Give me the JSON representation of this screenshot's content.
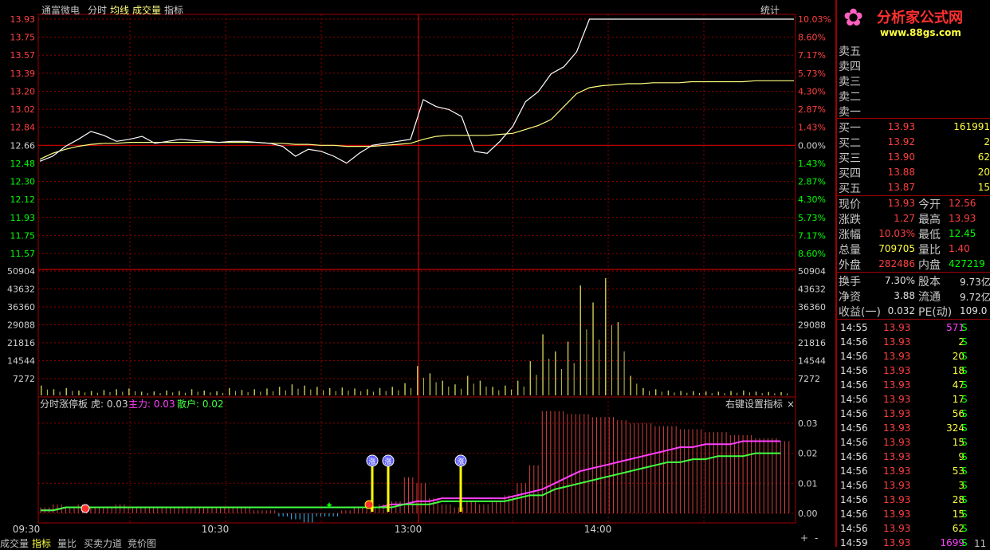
{
  "header": {
    "stock_name": "通富微电",
    "tab_minute": "分时",
    "tab_avg": "均线",
    "tab_volume": "成交量",
    "tab_indicator": "指标",
    "stats_button": "统计"
  },
  "price_axis": {
    "left_labels": [
      "13.93",
      "13.75",
      "13.57",
      "13.39",
      "13.20",
      "13.02",
      "12.84",
      "12.66",
      "12.48",
      "12.30",
      "12.12",
      "11.93",
      "11.75",
      "11.57"
    ],
    "right_labels": [
      "10.03%",
      "8.60%",
      "7.17%",
      "5.73%",
      "4.30%",
      "2.87%",
      "1.43%",
      "0.00%",
      "1.43%",
      "2.87%",
      "4.30%",
      "5.73%",
      "7.17%",
      "8.60%"
    ]
  },
  "volume_axis": {
    "labels": [
      "50904",
      "43632",
      "36360",
      "29088",
      "21816",
      "14544",
      "7272"
    ]
  },
  "indicator": {
    "name": "分时涨停板",
    "tiger_label": "虎: 0.03",
    "main_label": "主力: 0.03",
    "retail_label": "散户: 0.02",
    "right_settings": "右键设置指标",
    "close_mark": "×",
    "axis_labels": [
      "0.03",
      "0.02",
      "0.01",
      "0.00"
    ],
    "signal_marker": "涨"
  },
  "time_axis": [
    "09:30",
    "10:30",
    "13:00",
    "14:00"
  ],
  "bottom_tabs": [
    "成交量",
    "指标",
    "量比",
    "买卖力道",
    "竞价图"
  ],
  "zoom_buttons": [
    "+",
    "-"
  ],
  "brand": {
    "logo_text": "分析家公式网",
    "url": "www.88gs.com"
  },
  "order_book": {
    "sell": [
      {
        "label": "卖五"
      },
      {
        "label": "卖四"
      },
      {
        "label": "卖三"
      },
      {
        "label": "卖二"
      },
      {
        "label": "卖一"
      }
    ],
    "buy": [
      {
        "label": "买一",
        "price": "13.93",
        "vol": "161991"
      },
      {
        "label": "买二",
        "price": "13.92",
        "vol": "2"
      },
      {
        "label": "买三",
        "price": "13.90",
        "vol": "62"
      },
      {
        "label": "买四",
        "price": "13.88",
        "vol": "20"
      },
      {
        "label": "买五",
        "price": "13.87",
        "vol": "15"
      }
    ]
  },
  "quote": [
    {
      "l1": "现价",
      "v1": "13.93",
      "l2": "今开",
      "v2": "12.56"
    },
    {
      "l1": "涨跌",
      "v1": "1.27",
      "l2": "最高",
      "v2": "13.93"
    },
    {
      "l1": "涨幅",
      "v1": "10.03%",
      "l2": "最低",
      "v2": "12.45"
    },
    {
      "l1": "总量",
      "v1": "709705",
      "l2": "量比",
      "v2": "1.40"
    },
    {
      "l1": "外盘",
      "v1": "282486",
      "l2": "内盘",
      "v2": "427219"
    }
  ],
  "fundamentals": [
    {
      "l1": "换手",
      "v1": "7.30%",
      "l2": "股本",
      "v2": "9.73亿"
    },
    {
      "l1": "净资",
      "v1": "3.88",
      "l2": "流通",
      "v2": "9.72亿"
    },
    {
      "l1": "收益(一)",
      "v1": "0.032",
      "l2": "PE(动)",
      "v2": "109.0"
    }
  ],
  "ticks": [
    {
      "time": "14:55",
      "price": "13.93",
      "vol": "571",
      "side": "S"
    },
    {
      "time": "14:56",
      "price": "13.93",
      "vol": "2",
      "side": "S"
    },
    {
      "time": "14:56",
      "price": "13.93",
      "vol": "20",
      "side": "S"
    },
    {
      "time": "14:56",
      "price": "13.93",
      "vol": "18",
      "side": "S"
    },
    {
      "time": "14:56",
      "price": "13.93",
      "vol": "47",
      "side": "S"
    },
    {
      "time": "14:56",
      "price": "13.93",
      "vol": "17",
      "side": "S"
    },
    {
      "time": "14:56",
      "price": "13.93",
      "vol": "56",
      "side": "S"
    },
    {
      "time": "14:56",
      "price": "13.93",
      "vol": "324",
      "side": "S"
    },
    {
      "time": "14:56",
      "price": "13.93",
      "vol": "15",
      "side": "S"
    },
    {
      "time": "14:56",
      "price": "13.93",
      "vol": "9",
      "side": "S"
    },
    {
      "time": "14:56",
      "price": "13.93",
      "vol": "53",
      "side": "S"
    },
    {
      "time": "14:56",
      "price": "13.93",
      "vol": "3",
      "side": "S"
    },
    {
      "time": "14:56",
      "price": "13.93",
      "vol": "28",
      "side": "S"
    },
    {
      "time": "14:56",
      "price": "13.93",
      "vol": "15",
      "side": "S"
    },
    {
      "time": "14:56",
      "price": "13.93",
      "vol": "62",
      "side": "S"
    },
    {
      "time": "14:59",
      "price": "13.93",
      "vol": "1699",
      "side": "S"
    }
  ],
  "tick_last_extra": "11",
  "colors": {
    "up": "#ff4040",
    "down": "#00ff00",
    "grid": "#8b0000",
    "price_line": "#ffffff",
    "avg_line": "#ffff80",
    "main": "#ff40ff",
    "retail": "#40ff40",
    "volume": "#c0c050"
  },
  "chart_data": {
    "type": "line",
    "title": "",
    "x_labels": [
      "09:30",
      "10:30",
      "13:00",
      "14:00"
    ],
    "ylim": [
      11.39,
      13.93
    ],
    "prev_close": 12.66,
    "series": [
      {
        "values": [
          12.5,
          12.55,
          12.65,
          12.72,
          12.8,
          12.76,
          12.7,
          12.72,
          12.75,
          12.68,
          12.7,
          12.72,
          12.71,
          12.7,
          12.69,
          12.7,
          12.7,
          12.69,
          12.68,
          12.65,
          12.55,
          12.62,
          12.6,
          12.55,
          12.48,
          12.58,
          12.66,
          12.68,
          12.7,
          12.72,
          13.12,
          13.05,
          13.02,
          12.95,
          12.6,
          12.58,
          12.7,
          12.85,
          13.1,
          13.2,
          13.38,
          13.45,
          13.6,
          13.93,
          13.93,
          13.93,
          13.93,
          13.93,
          13.93,
          13.93,
          13.93,
          13.93,
          13.93,
          13.93,
          13.93,
          13.93,
          13.93,
          13.93,
          13.93,
          13.93
        ]
      },
      {
        "values": [
          12.52,
          12.58,
          12.62,
          12.65,
          12.67,
          12.68,
          12.68,
          12.69,
          12.69,
          12.69,
          12.69,
          12.69,
          12.69,
          12.69,
          12.69,
          12.69,
          12.69,
          12.69,
          12.68,
          12.68,
          12.67,
          12.67,
          12.66,
          12.66,
          12.65,
          12.65,
          12.65,
          12.66,
          12.67,
          12.68,
          12.72,
          12.75,
          12.76,
          12.76,
          12.76,
          12.76,
          12.77,
          12.78,
          12.82,
          12.86,
          12.92,
          13.05,
          13.18,
          13.24,
          13.26,
          13.27,
          13.28,
          13.28,
          13.29,
          13.29,
          13.29,
          13.3,
          13.3,
          13.3,
          13.3,
          13.3,
          13.31,
          13.31,
          13.31,
          13.31
        ]
      }
    ],
    "volume": {
      "ylim": [
        0,
        50904
      ],
      "values": [
        4000,
        2500,
        3000,
        2000,
        1800,
        2200,
        2500,
        2800,
        1500,
        1600,
        2000,
        1800,
        2500,
        2000,
        1700,
        3000,
        2200,
        2500,
        2800,
        3500,
        4500,
        4000,
        3500,
        3000,
        3200,
        2800,
        2500,
        3000,
        3500,
        5000,
        12000,
        9000,
        6000,
        4500,
        8000,
        6000,
        3500,
        4000,
        6000,
        14000,
        25000,
        18000,
        22000,
        45000,
        38000,
        48000,
        30000,
        8000,
        3000,
        2500,
        2000,
        1800,
        1700,
        1600,
        1500,
        1800,
        2000,
        1500,
        1400,
        1300
      ]
    },
    "indicator": {
      "ylim": [
        0,
        0.035
      ],
      "main": [
        0.001,
        0.001,
        0.002,
        0.002,
        0.002,
        0.002,
        0.002,
        0.002,
        0.002,
        0.002,
        0.002,
        0.002,
        0.002,
        0.002,
        0.002,
        0.002,
        0.002,
        0.002,
        0.002,
        0.002,
        0.002,
        0.002,
        0.002,
        0.002,
        0.002,
        0.002,
        0.002,
        0.002,
        0.003,
        0.003,
        0.004,
        0.004,
        0.005,
        0.005,
        0.005,
        0.005,
        0.005,
        0.005,
        0.006,
        0.007,
        0.008,
        0.01,
        0.012,
        0.014,
        0.015,
        0.016,
        0.017,
        0.018,
        0.019,
        0.02,
        0.021,
        0.022,
        0.022,
        0.023,
        0.023,
        0.023,
        0.024,
        0.024,
        0.024,
        0.024
      ],
      "retail": [
        0.001,
        0.001,
        0.002,
        0.002,
        0.002,
        0.002,
        0.002,
        0.002,
        0.002,
        0.002,
        0.002,
        0.002,
        0.002,
        0.002,
        0.002,
        0.002,
        0.002,
        0.002,
        0.002,
        0.002,
        0.002,
        0.002,
        0.002,
        0.002,
        0.002,
        0.002,
        0.002,
        0.002,
        0.002,
        0.003,
        0.003,
        0.003,
        0.004,
        0.004,
        0.004,
        0.004,
        0.004,
        0.004,
        0.005,
        0.006,
        0.006,
        0.008,
        0.009,
        0.01,
        0.011,
        0.012,
        0.013,
        0.014,
        0.015,
        0.016,
        0.017,
        0.017,
        0.018,
        0.018,
        0.019,
        0.019,
        0.019,
        0.02,
        0.02,
        0.02
      ],
      "bars": [
        0.002,
        0.003,
        0.002,
        0.003,
        0.002,
        0.002,
        0.003,
        0.002,
        0.002,
        0.002,
        0.002,
        0.002,
        0.002,
        0.002,
        0.002,
        0.002,
        0.002,
        0.001,
        0.001,
        -0.001,
        -0.002,
        -0.003,
        -0.001,
        -0.001,
        0.001,
        0.002,
        0.002,
        0.003,
        0.004,
        0.012,
        0.01,
        0.005,
        0.003,
        0.002,
        0.004,
        0.003,
        0.004,
        0.006,
        0.01,
        0.016,
        0.034,
        0.034,
        0.033,
        0.033,
        0.032,
        0.032,
        0.031,
        0.03,
        0.03,
        0.029,
        0.029,
        0.028,
        0.028,
        0.027,
        0.027,
        0.026,
        0.026,
        0.025,
        0.025,
        0.024
      ]
    }
  }
}
